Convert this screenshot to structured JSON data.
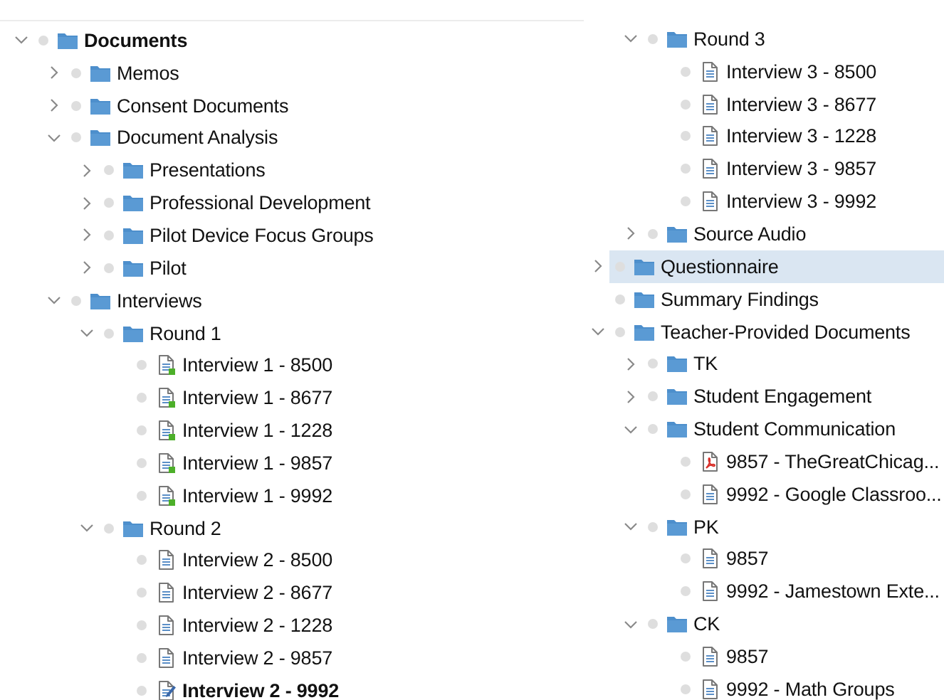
{
  "panes": [
    {
      "tree": [
        {
          "label": "Documents",
          "kind": "folder",
          "expanded": true,
          "bold": true,
          "selected": false,
          "children": [
            {
              "label": "Memos",
              "kind": "folder",
              "expanded": false,
              "selected": false
            },
            {
              "label": "Consent Documents",
              "kind": "folder",
              "expanded": false,
              "selected": false
            },
            {
              "label": "Document Analysis",
              "kind": "folder",
              "expanded": true,
              "selected": false,
              "children": [
                {
                  "label": "Presentations",
                  "kind": "folder",
                  "expanded": false,
                  "selected": false
                },
                {
                  "label": "Professional Development",
                  "kind": "folder",
                  "expanded": false,
                  "selected": false
                },
                {
                  "label": "Pilot Device Focus Groups",
                  "kind": "folder",
                  "expanded": false,
                  "selected": false
                },
                {
                  "label": "Pilot",
                  "kind": "folder",
                  "expanded": false,
                  "selected": false
                }
              ]
            },
            {
              "label": "Interviews",
              "kind": "folder",
              "expanded": true,
              "selected": false,
              "children": [
                {
                  "label": "Round 1",
                  "kind": "folder",
                  "expanded": true,
                  "selected": false,
                  "children": [
                    {
                      "label": "Interview 1 - 8500",
                      "kind": "coded",
                      "selected": false
                    },
                    {
                      "label": "Interview 1 - 8677",
                      "kind": "coded",
                      "selected": false
                    },
                    {
                      "label": "Interview 1 - 1228",
                      "kind": "coded",
                      "selected": false
                    },
                    {
                      "label": "Interview 1 - 9857",
                      "kind": "coded",
                      "selected": false
                    },
                    {
                      "label": "Interview 1 - 9992",
                      "kind": "coded",
                      "selected": false
                    }
                  ]
                },
                {
                  "label": "Round 2",
                  "kind": "folder",
                  "expanded": true,
                  "selected": false,
                  "children": [
                    {
                      "label": "Interview 2 - 8500",
                      "kind": "text",
                      "selected": false
                    },
                    {
                      "label": "Interview 2 - 8677",
                      "kind": "text",
                      "selected": false
                    },
                    {
                      "label": "Interview 2 - 1228",
                      "kind": "text",
                      "selected": false
                    },
                    {
                      "label": "Interview 2 - 9857",
                      "kind": "text",
                      "selected": false
                    },
                    {
                      "label": "Interview 2 - 9992",
                      "kind": "edited",
                      "bold": true,
                      "selected": false
                    }
                  ]
                }
              ]
            }
          ]
        }
      ]
    },
    {
      "tree": [
        {
          "children": [
            {
              "children": [
                {
                  "label": "Round 3",
                  "kind": "folder",
                  "expanded": true,
                  "selected": false,
                  "children": [
                    {
                      "label": "Interview 3 - 8500",
                      "kind": "text",
                      "selected": false
                    },
                    {
                      "label": "Interview 3 - 8677",
                      "kind": "text",
                      "selected": false
                    },
                    {
                      "label": "Interview 3 - 1228",
                      "kind": "text",
                      "selected": false
                    },
                    {
                      "label": "Interview 3 - 9857",
                      "kind": "text",
                      "selected": false
                    },
                    {
                      "label": "Interview 3 - 9992",
                      "kind": "text",
                      "selected": false
                    }
                  ]
                },
                {
                  "label": "Source Audio",
                  "kind": "folder",
                  "expanded": false,
                  "selected": false
                }
              ]
            },
            {
              "label": "Questionnaire",
              "kind": "folder",
              "expanded": false,
              "selected": true
            },
            {
              "label": "Summary Findings",
              "kind": "folder",
              "selected": false
            },
            {
              "label": "Teacher-Provided Documents",
              "kind": "folder",
              "expanded": true,
              "selected": false,
              "children": [
                {
                  "label": "TK",
                  "kind": "folder",
                  "expanded": false,
                  "selected": false
                },
                {
                  "label": "Student Engagement",
                  "kind": "folder",
                  "expanded": false,
                  "selected": false
                },
                {
                  "label": "Student Communication",
                  "kind": "folder",
                  "expanded": true,
                  "selected": false,
                  "children": [
                    {
                      "label": "9857 - TheGreatChicag...",
                      "kind": "pdf",
                      "selected": false
                    },
                    {
                      "label": "9992 - Google Classroo...",
                      "kind": "text",
                      "selected": false
                    }
                  ]
                },
                {
                  "label": "PK",
                  "kind": "folder",
                  "expanded": true,
                  "selected": false,
                  "children": [
                    {
                      "label": "9857",
                      "kind": "text",
                      "selected": false
                    },
                    {
                      "label": "9992 - Jamestown Exte...",
                      "kind": "text",
                      "selected": false
                    }
                  ]
                },
                {
                  "label": "CK",
                  "kind": "folder",
                  "expanded": true,
                  "selected": false,
                  "children": [
                    {
                      "label": "9857",
                      "kind": "text",
                      "selected": false
                    },
                    {
                      "label": "9992 - Math Groups",
                      "kind": "text",
                      "selected": false
                    }
                  ]
                }
              ]
            }
          ]
        }
      ]
    }
  ]
}
